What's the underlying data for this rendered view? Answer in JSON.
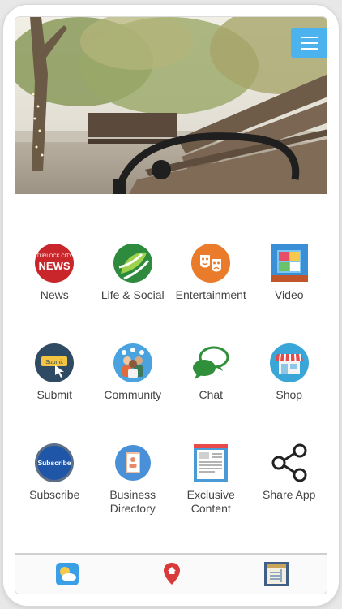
{
  "colors": {
    "menu": "#4db3ef",
    "label": "#444444"
  },
  "header": {
    "menu_icon": "hamburger-icon"
  },
  "tiles": [
    {
      "label": "News",
      "icon": "news-icon",
      "badge_top": "TURLOCK CITY",
      "badge_main": "NEWS"
    },
    {
      "label": "Life & Social",
      "icon": "leaf-icon"
    },
    {
      "label": "Entertainment",
      "icon": "theater-masks-icon"
    },
    {
      "label": "Video",
      "icon": "video-icon"
    },
    {
      "label": "Submit",
      "icon": "submit-icon",
      "badge_text": "Submit"
    },
    {
      "label": "Community",
      "icon": "community-icon"
    },
    {
      "label": "Chat",
      "icon": "chat-icon"
    },
    {
      "label": "Shop",
      "icon": "shop-icon"
    },
    {
      "label": "Subscribe",
      "icon": "subscribe-icon",
      "badge_text": "Subscribe"
    },
    {
      "label": "Business\nDirectory",
      "icon": "directory-icon"
    },
    {
      "label": "Exclusive\nContent",
      "icon": "document-icon"
    },
    {
      "label": "Share App",
      "icon": "share-icon"
    }
  ],
  "bottom_nav": [
    {
      "icon": "weather-icon"
    },
    {
      "icon": "map-pin-icon"
    },
    {
      "icon": "calendar-icon"
    }
  ]
}
